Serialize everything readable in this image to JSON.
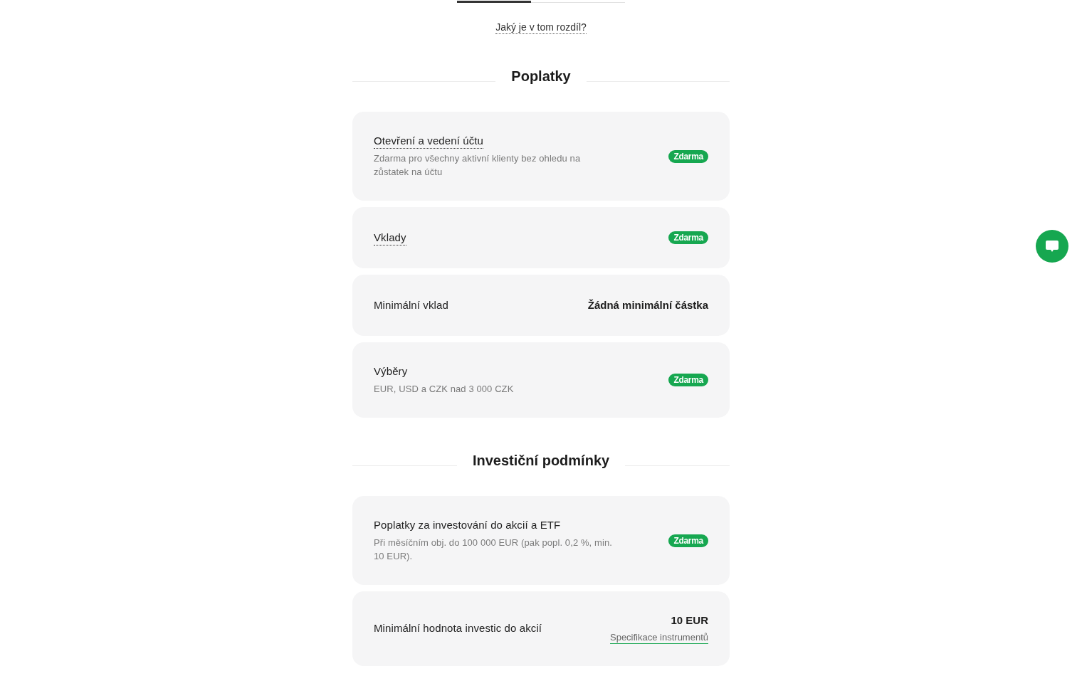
{
  "tabs": [
    {
      "selected": true
    },
    {
      "selected": false
    }
  ],
  "difference_link": "Jaký je v tom rozdíl?",
  "sections": [
    {
      "title": "Poplatky",
      "rows": [
        {
          "kind": "badge",
          "label": "Otevření a vedení účtu",
          "tooltip": true,
          "description": "Zdarma pro všechny aktivní klienty bez ohledu na zůstatek na účtu",
          "badge": "Zdarma"
        },
        {
          "kind": "badge",
          "label": "Vklady",
          "tooltip": true,
          "badge": "Zdarma"
        },
        {
          "kind": "value",
          "label": "Minimální vklad",
          "tooltip": false,
          "value": "Žádná minimální částka"
        },
        {
          "kind": "badge",
          "label": "Výběry",
          "tooltip": false,
          "description": "EUR, USD a CZK nad 3 000 CZK",
          "badge": "Zdarma"
        }
      ]
    },
    {
      "title": "Investiční podmínky",
      "rows": [
        {
          "kind": "badge",
          "label": "Poplatky za investování do akcií a ETF",
          "tooltip": false,
          "description": "Při měsíčním obj. do 100 000 EUR (pak popl. 0,2 %, min. 10 EUR).",
          "badge": "Zdarma"
        },
        {
          "kind": "value",
          "label": "Minimální hodnota investic do akcií",
          "tooltip": false,
          "value": "10 EUR",
          "link": "Specifikace instrumentů"
        }
      ]
    }
  ]
}
